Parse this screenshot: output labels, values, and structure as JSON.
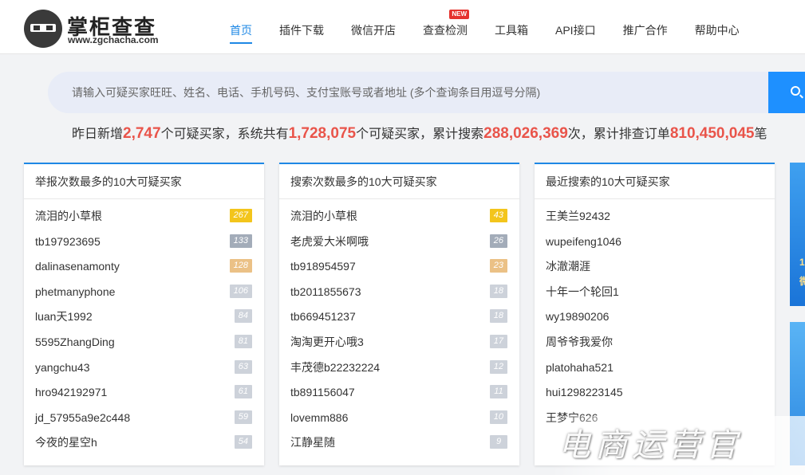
{
  "brand": {
    "name_cn": "掌柜查查",
    "url": "www.zgchacha.com"
  },
  "nav": {
    "items": [
      {
        "label": "首页",
        "active": true
      },
      {
        "label": "插件下载"
      },
      {
        "label": "微信开店"
      },
      {
        "label": "查查检测",
        "badge": "NEW"
      },
      {
        "label": "工具箱"
      },
      {
        "label": "API接口"
      },
      {
        "label": "推广合作"
      },
      {
        "label": "帮助中心"
      }
    ]
  },
  "search": {
    "placeholder": "请输入可疑买家旺旺、姓名、电话、手机号码、支付宝账号或者地址 (多个查询条目用逗号分隔)",
    "value": ""
  },
  "stats": {
    "p1": "昨日新增",
    "n1": "2,747",
    "p2": "个可疑买家，系统共有",
    "n2": "1,728,075",
    "p3": "个可疑买家，累计搜索",
    "n3": "288,026,369",
    "p4": "次，累计排查订单",
    "n4": "810,450,045",
    "p5": "笔"
  },
  "colors": {
    "accent": "#1e88e5",
    "highlight_number": "#e9544a",
    "badge_gold": "#f3c51c",
    "badge_slate": "#a3acb9",
    "badge_orange": "#ebc186",
    "badge_light": "#cdd2da"
  },
  "panels": [
    {
      "title": "举报次数最多的10大可疑买家",
      "items": [
        {
          "name": "流泪的小草根",
          "count": "267"
        },
        {
          "name": "tb197923695",
          "count": "133"
        },
        {
          "name": "dalinasenamonty",
          "count": "128"
        },
        {
          "name": "phetmanyphone",
          "count": "106"
        },
        {
          "name": "luan天1992",
          "count": "84"
        },
        {
          "name": "5595ZhangDing",
          "count": "81"
        },
        {
          "name": "yangchu43",
          "count": "63"
        },
        {
          "name": "hro942192971",
          "count": "61"
        },
        {
          "name": "jd_57955a9e2c448",
          "count": "59"
        },
        {
          "name": "今夜的星空h",
          "count": "54"
        }
      ]
    },
    {
      "title": "搜索次数最多的10大可疑买家",
      "items": [
        {
          "name": "流泪的小草根",
          "count": "43"
        },
        {
          "name": "老虎爱大米啊哦",
          "count": "26"
        },
        {
          "name": "tb918954597",
          "count": "23"
        },
        {
          "name": "tb2011855673",
          "count": "18"
        },
        {
          "name": "tb669451237",
          "count": "18"
        },
        {
          "name": "淘淘更开心哦3",
          "count": "17"
        },
        {
          "name": "丰茂德b22232224",
          "count": "12"
        },
        {
          "name": "tb891156047",
          "count": "11"
        },
        {
          "name": "lovemm886",
          "count": "10"
        },
        {
          "name": "江静星随",
          "count": "9"
        }
      ]
    },
    {
      "title": "最近搜索的10大可疑买家",
      "items": [
        {
          "name": "王美兰92432"
        },
        {
          "name": "wupeifeng1046"
        },
        {
          "name": "冰澈潮涯"
        },
        {
          "name": "十年一个轮回1"
        },
        {
          "name": "wy19890206"
        },
        {
          "name": "周爷爷我爱你"
        },
        {
          "name": "platohaha521"
        },
        {
          "name": "hui1298223145"
        },
        {
          "name": "王梦宁626"
        }
      ]
    }
  ],
  "side_banner": {
    "line1": "1",
    "line2": "微"
  },
  "watermark": "电商运营官"
}
